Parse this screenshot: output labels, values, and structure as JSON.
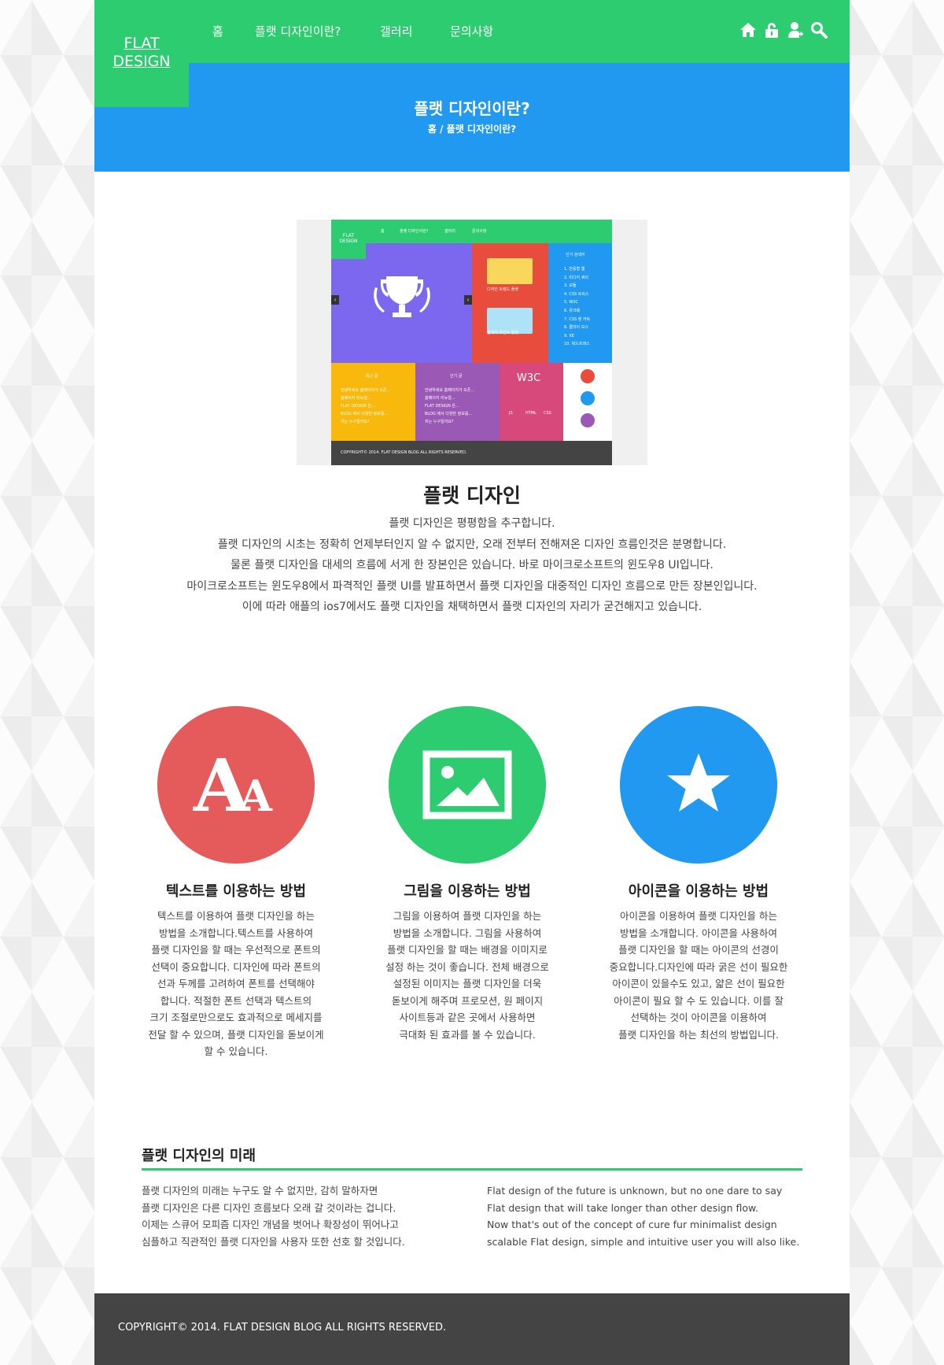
{
  "colors": {
    "green": "#2ecc71",
    "blue": "#2199f1",
    "red": "#e55a5a",
    "footer": "#444444",
    "divider": "#2ecc71"
  },
  "header": {
    "logo_line1": "FLAT",
    "logo_line2": "DESIGN",
    "nav": {
      "home": "홈",
      "flat": "플랫 디자인이란?",
      "gallery": "갤러리",
      "contact": "문의사항"
    },
    "utility_icons": [
      "home-icon",
      "lock-icon",
      "user-icon",
      "search-icon"
    ]
  },
  "page_banner": {
    "title": "플랫 디자인이란?",
    "breadcrumb": "홈 / 플랫 디자인이란?"
  },
  "preview": {
    "logo_line1": "FLAT",
    "logo_line2": "DESIGN",
    "nav": [
      "홈",
      "플랫 디자인이란?",
      "갤러리",
      "문의사항"
    ],
    "red_tile": [
      "디자인 트렌드 플랫",
      "원색의 포인트 플랫"
    ],
    "blue_tile_title": "인기 검색어",
    "blue_tile_list": [
      "1. 반응형 웹",
      "2. 미디어 쿼리",
      "3. 모듈",
      "4. CSS 트릭스",
      "5. W3C",
      "6. 뮤크웨",
      "7. CSS 랜 커트",
      "8. 클리어 보스",
      "9. XE",
      "10. 워드프레스"
    ],
    "yellow_tile_title": "최근 글",
    "violet_tile_title": "인기 글",
    "post_list": [
      "안녕하세요 홈페이지가 오픈...",
      "홈페이지 리뉴얼...",
      "FLAT DESIGN 은...",
      "BLOG 에서 다양한 정보를...",
      "저는 누구일까요?"
    ],
    "w3c_label": "W3C",
    "tech_labels": [
      "JS",
      "HTML",
      "CSS"
    ],
    "footer": "COPYRIGHT© 2014. FLAT DESIGN BLOG ALL RIGHTS RESERVED."
  },
  "article": {
    "title": "플랫 디자인",
    "lines": [
      "플랫 디자인은 평평함을 추구합니다.",
      "플랫 디자인의 시초는 정확히 언제부터인지 알 수 없지만, 오래 전부터 전해져온 디자인 흐름인것은 분명합니다.",
      "물론 플랫 디자인을 대세의 흐름에 서게 한 장본인은 있습니다. 바로 마이크로소프트의 윈도우8 UI입니다.",
      "마이크로소프트는 윈도우8에서 파격적인 플랫 UI를 발표하면서 플랫 디자인을 대중적인 디자인 흐름으로 만든 장본인입니다.",
      "이에 따라 애플의 ios7에서도 플랫 디자인을 채택하면서 플랫 디자인의 자리가 굳건해지고 있습니다."
    ]
  },
  "features": [
    {
      "icon": "font-icon",
      "icon_label": "Aa",
      "color": "#e55a5a",
      "title": "텍스트를 이용하는 방법",
      "lines": [
        "텍스트를 이용하여 플랫 디자인을 하는",
        "방법을 소개합니다.텍스트를 사용하여",
        "플랫 디자인을 할 때는 우선적으로 폰트의",
        "선택이 중요합니다. 디자인에 따라 폰트의",
        "선과 두께를 고려하여 폰트를 선택해야",
        "합니다. 적절한 폰트 선택과 텍스트의",
        "크기 조절로만으로도 효과적으로 메세지를",
        "전달 할 수 있으며, 플랫 디자인을 돋보이게",
        "할 수 있습니다."
      ]
    },
    {
      "icon": "image-icon",
      "color": "#2ecc71",
      "title": "그림을 이용하는 방법",
      "lines": [
        "그림을 이용하여 플랫 디자인을 하는",
        "방법을 소개합니다. 그림을 사용하여",
        "플랫 디자인을 할 때는 배경을 이미지로",
        "설정 하는 것이 좋습니다. 전체 배경으로",
        "설정된 이미지는 플랫 디자인을 더욱",
        "돋보이게 해주며 프로모션, 원 페이지",
        "사이트등과 같은 곳에서 사용하면",
        "극대화 된 효과를 볼 수 있습니다."
      ]
    },
    {
      "icon": "star-icon",
      "color": "#2199f1",
      "title": "아이콘을 이용하는 방법",
      "lines": [
        "아이콘을 이용하여 플랫 디자인을 하는",
        "방법을 소개합니다. 아이콘을 사용하여",
        "플랫 디자인을 할 때는 아이콘의 선경이",
        "중요합니다.디자인에 따라 굵은 선이 필요한",
        "아이콘이 있을수도 있고, 얇은 선이 필요한",
        "아이콘이 필요 할 수 도 있습니다. 이를 잘",
        "선택하는 것이 아이콘을 이용하여",
        "플랫 디자인을 하는 최선의 방법입니다."
      ]
    }
  ],
  "future": {
    "title": "플랫 디자인의 미래",
    "left": [
      "플랫 디자인의 미래는 누구도 알 수 없지만, 감히 말하자면",
      "플랫 디자인은 다른 디자인 흐름보다 오래 갈 것이라는 겁니다.",
      "이제는 스큐어 모피즘 디자인 개념을 벗어나 확장성이 뛰어나고",
      "심플하고 직관적인 플랫 디자인을 사용자 또한 선호 할 것입니다."
    ],
    "right": [
      "Flat design of the future is unknown, but no one dare to say",
      "Flat design that will take longer than other design flow.",
      "Now that's out of the concept of cure fur minimalist design",
      "scalable  Flat design, simple and intuitive user you will also like."
    ]
  },
  "footer": {
    "copyright": "COPYRIGHT© 2014. FLAT DESIGN BLOG ALL RIGHTS RESERVED."
  }
}
